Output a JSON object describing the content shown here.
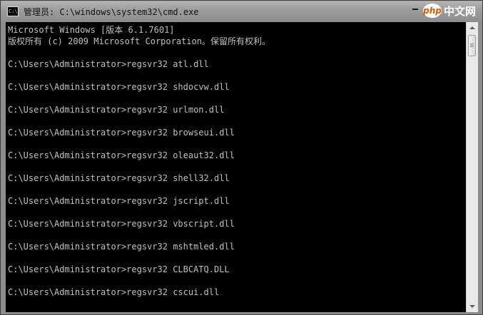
{
  "window": {
    "title": "管理员: C:\\windows\\system32\\cmd.exe",
    "icon": "C:\\"
  },
  "watermark": {
    "logo": "php",
    "text": "中文网"
  },
  "console": {
    "lines": [
      "Microsoft Windows [版本 6.1.7601]",
      "版权所有 (c) 2009 Microsoft Corporation。保留所有权利。",
      "C:\\Users\\Administrator>regsvr32 atl.dll",
      "C:\\Users\\Administrator>regsvr32 shdocvw.dll",
      "C:\\Users\\Administrator>regsvr32 urlmon.dll",
      "C:\\Users\\Administrator>regsvr32 browseui.dll",
      "C:\\Users\\Administrator>regsvr32 oleaut32.dll",
      "C:\\Users\\Administrator>regsvr32 shell32.dll",
      "C:\\Users\\Administrator>regsvr32 jscript.dll",
      "C:\\Users\\Administrator>regsvr32 vbscript.dll",
      "C:\\Users\\Administrator>regsvr32 mshtmled.dll",
      "C:\\Users\\Administrator>regsvr32 CLBCATQ.DLL",
      "C:\\Users\\Administrator>regsvr32 cscui.dll"
    ]
  },
  "colors": {
    "console_bg": "#000000",
    "console_text": "#c0c0c0",
    "titlebar": "#9c9c9c"
  }
}
